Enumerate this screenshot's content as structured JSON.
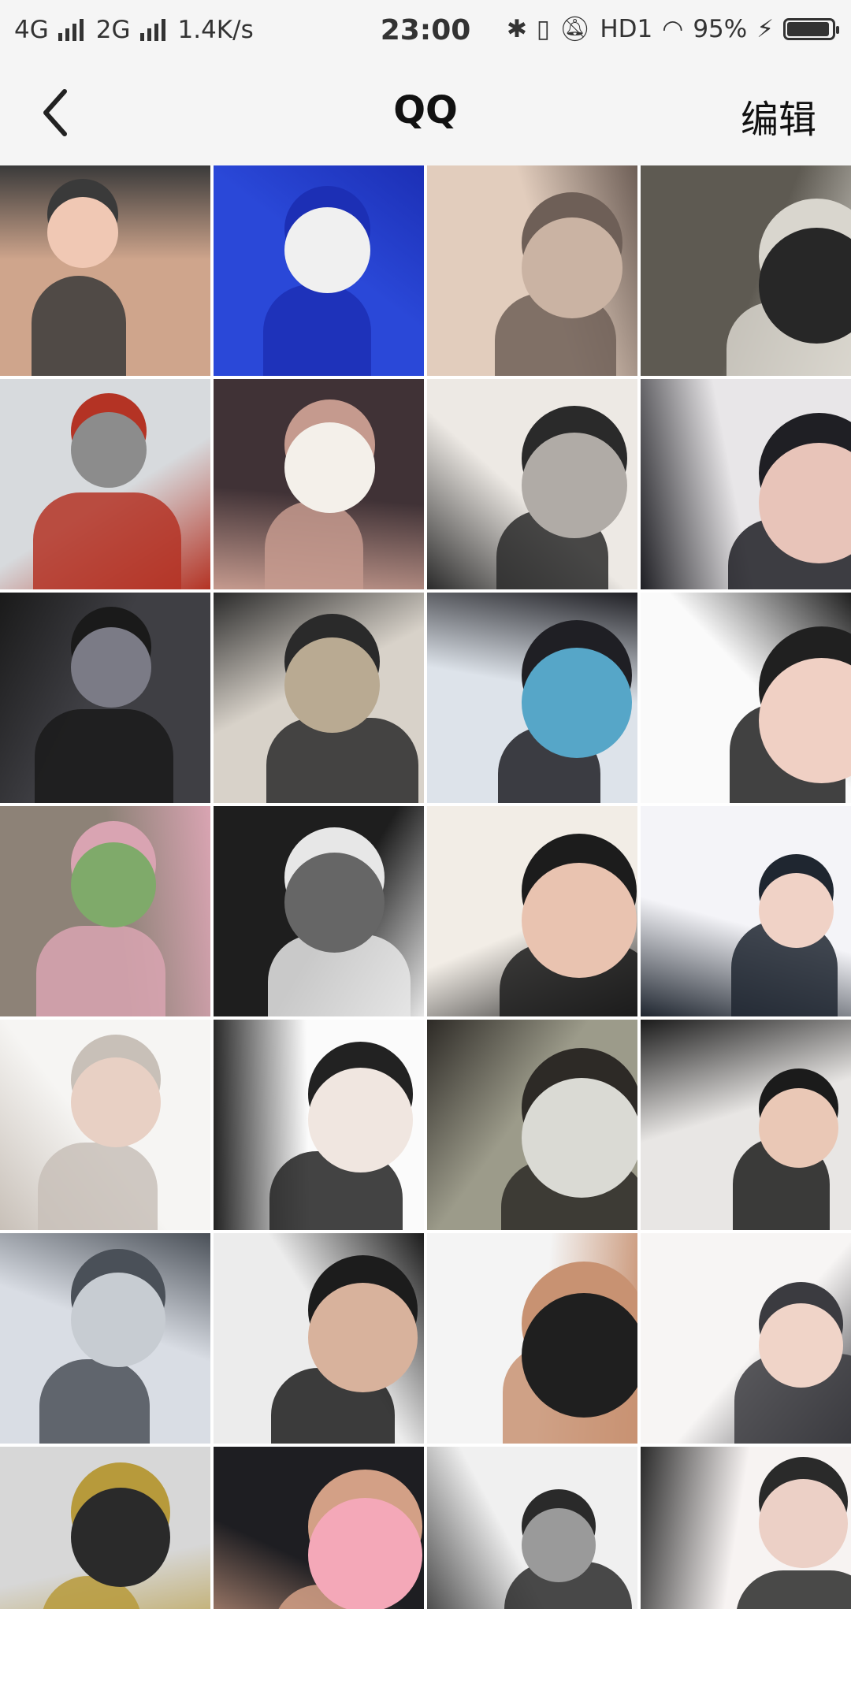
{
  "status_bar": {
    "network1": "4G",
    "network2": "2G",
    "speed": "1.4K/s",
    "time": "23:00",
    "hd": "HD1",
    "battery_percent": "95%",
    "battery_level": 0.95
  },
  "header": {
    "title": "QQ",
    "edit_label": "编辑",
    "back_icon": "back-chevron-icon"
  },
  "gallery": {
    "photos": [
      {
        "name": "photo-01",
        "colors": [
          "#cfa58c",
          "#3a3a3a",
          "#f0c8b4"
        ]
      },
      {
        "name": "photo-02",
        "colors": [
          "#2a48d8",
          "#1c2fb5",
          "#f0f0f0"
        ]
      },
      {
        "name": "photo-03",
        "colors": [
          "#e2cdbd",
          "#6e5f57",
          "#cab3a3"
        ]
      },
      {
        "name": "photo-04",
        "colors": [
          "#5e5a52",
          "#d9d6ce",
          "#272727"
        ]
      },
      {
        "name": "photo-05",
        "colors": [
          "#d7dadd",
          "#b43324",
          "#8c8c8c"
        ]
      },
      {
        "name": "photo-06",
        "colors": [
          "#403236",
          "#c59a8e",
          "#f4f0ea"
        ]
      },
      {
        "name": "photo-07",
        "colors": [
          "#ede9e4",
          "#2a2a2a",
          "#b0aba6"
        ]
      },
      {
        "name": "photo-08",
        "colors": [
          "#e8e6e8",
          "#1f1f24",
          "#e8c4b9"
        ]
      },
      {
        "name": "photo-09",
        "colors": [
          "#3f3f44",
          "#1a1a1a",
          "#7b7b86"
        ]
      },
      {
        "name": "photo-10",
        "colors": [
          "#d8d2c9",
          "#2a2a2a",
          "#b9aa92"
        ]
      },
      {
        "name": "photo-11",
        "colors": [
          "#dde3ea",
          "#1f1f24",
          "#56a6c8"
        ]
      },
      {
        "name": "photo-12",
        "colors": [
          "#fafafa",
          "#202020",
          "#f0d0c4"
        ]
      },
      {
        "name": "photo-13",
        "colors": [
          "#8d8277",
          "#d9a4b2",
          "#7faa6a"
        ]
      },
      {
        "name": "photo-14",
        "colors": [
          "#1e1e1e",
          "#e7e7e7",
          "#666666"
        ]
      },
      {
        "name": "photo-15",
        "colors": [
          "#f2ede6",
          "#1c1c1c",
          "#e9c3b0"
        ]
      },
      {
        "name": "photo-16",
        "colors": [
          "#f4f4f8",
          "#1f2630",
          "#f0d2c6"
        ]
      },
      {
        "name": "photo-17",
        "colors": [
          "#f6f5f3",
          "#c8c0b8",
          "#e8d0c4"
        ]
      },
      {
        "name": "photo-18",
        "colors": [
          "#fbfbfb",
          "#222222",
          "#f0e6e0"
        ]
      },
      {
        "name": "photo-19",
        "colors": [
          "#9c9b8a",
          "#2d2a26",
          "#dadad4"
        ]
      },
      {
        "name": "photo-20",
        "colors": [
          "#e8e6e4",
          "#1b1b1b",
          "#eac8b6"
        ]
      },
      {
        "name": "photo-21",
        "colors": [
          "#d9dde4",
          "#4a5058",
          "#c7ccd2"
        ]
      },
      {
        "name": "photo-22",
        "colors": [
          "#ececec",
          "#1c1c1c",
          "#d8b29c"
        ]
      },
      {
        "name": "photo-23",
        "colors": [
          "#f4f4f4",
          "#c89272",
          "#1f1f1f"
        ]
      },
      {
        "name": "photo-24",
        "colors": [
          "#f7f5f4",
          "#3b3b40",
          "#f0d4c8"
        ]
      },
      {
        "name": "photo-25",
        "colors": [
          "#d7d7d7",
          "#b79a3b",
          "#2a2a2a"
        ]
      },
      {
        "name": "photo-26",
        "colors": [
          "#1e1e22",
          "#d3a086",
          "#f4a8b8"
        ]
      },
      {
        "name": "photo-27",
        "colors": [
          "#f0f0f0",
          "#2a2a2a",
          "#9a9a9a"
        ]
      },
      {
        "name": "photo-28",
        "colors": [
          "#f7f3f2",
          "#2a2a2a",
          "#ecd0c6"
        ]
      }
    ]
  }
}
